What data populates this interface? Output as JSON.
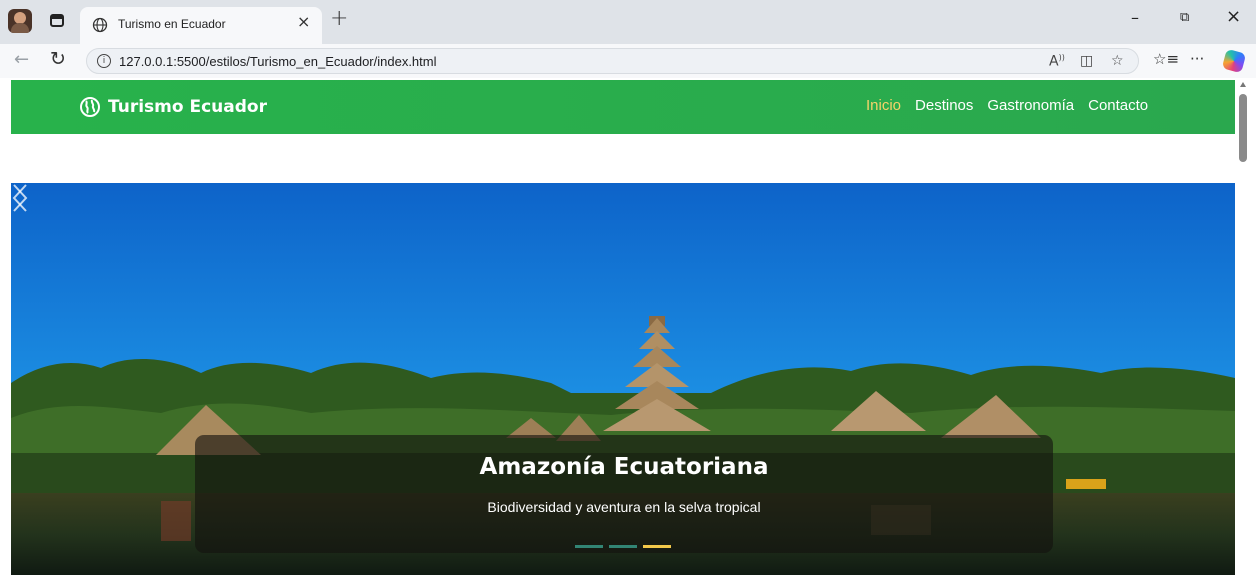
{
  "browser": {
    "tab": {
      "title": "Turismo en Ecuador",
      "close_glyph": "×"
    },
    "new_tab_glyph": "+",
    "window_controls": {
      "minimize": "–",
      "restore": "⧉",
      "close": "×"
    },
    "address": {
      "url": "127.0.0.1:5500/estilos/Turismo_en_Ecuador/index.html"
    },
    "toolbar_icons": [
      "read-aloud-icon",
      "split-screen-icon",
      "favorite-star-icon",
      "favorites-list-icon",
      "more-icon",
      "copilot-icon"
    ]
  },
  "site": {
    "brand": "Turismo Ecuador",
    "nav": [
      {
        "label": "Inicio",
        "active": true
      },
      {
        "label": "Destinos",
        "active": false
      },
      {
        "label": "Gastronomía",
        "active": false
      },
      {
        "label": "Contacto",
        "active": false
      }
    ],
    "accent_color": "#28b24b",
    "active_link_color": "#f5d36a"
  },
  "carousel": {
    "caption_title": "Amazonía Ecuatoriana",
    "caption_text": "Biodiversidad y aventura en la selva tropical",
    "slides_count": 3,
    "active_slide": 3
  }
}
